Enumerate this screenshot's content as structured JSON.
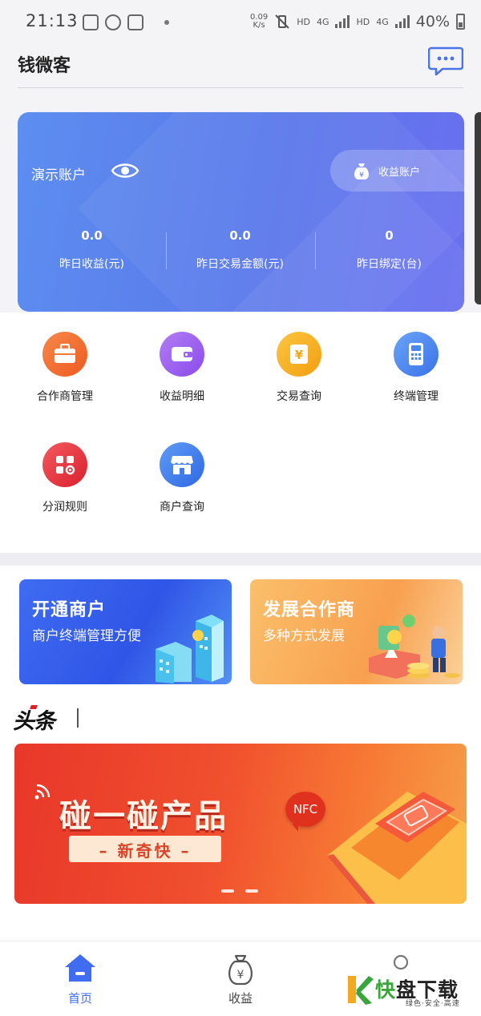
{
  "status_bar": {
    "time": "21:13",
    "speed_value": "0.09",
    "speed_unit": "K/s",
    "hd1": "HD",
    "net1": "4G",
    "hd2": "HD",
    "net2": "4G",
    "battery": "40%"
  },
  "header": {
    "title": "钱微客"
  },
  "account_card": {
    "name": "演示账户",
    "account_button_label": "收益账户",
    "stats": [
      {
        "value": "0.0",
        "label": "昨日收益(元)"
      },
      {
        "value": "0.0",
        "label": "昨日交易金额(元)"
      },
      {
        "value": "0",
        "label": "昨日绑定(台)"
      }
    ]
  },
  "menu": [
    {
      "label": "合作商管理",
      "icon": "briefcase-icon",
      "color": "#f2672a"
    },
    {
      "label": "收益明细",
      "icon": "wallet-icon",
      "color": "#9a5ef0"
    },
    {
      "label": "交易查询",
      "icon": "yen-document-icon",
      "color": "#f7b020"
    },
    {
      "label": "终端管理",
      "icon": "pos-terminal-icon",
      "color": "#4a86f0"
    },
    {
      "label": "分润规则",
      "icon": "grid-gear-icon",
      "color": "#e8343f"
    },
    {
      "label": "商户查询",
      "icon": "store-icon",
      "color": "#3d7ef0"
    }
  ],
  "promos": [
    {
      "title": "开通商户",
      "subtitle": "商户终端管理方便"
    },
    {
      "title": "发展合作商",
      "subtitle": "多种方式发展"
    }
  ],
  "headlines": {
    "logo_text": "头条"
  },
  "banner": {
    "title": "碰一碰产品",
    "subtitle": "– 新奇快 –",
    "badge": "NFC"
  },
  "bottom_nav": [
    {
      "label": "首页",
      "icon": "home-icon",
      "active": true
    },
    {
      "label": "收益",
      "icon": "money-bag-icon",
      "active": false
    },
    {
      "label": "",
      "icon": "user-icon",
      "active": false
    }
  ],
  "watermark": {
    "brand_k": "快",
    "brand_rest": "盘下载",
    "tagline": "绿色·安全·高速"
  },
  "colors": {
    "primary": "#4a72ea",
    "nav_active": "#3f6cf0",
    "nav_inactive": "#555555"
  }
}
